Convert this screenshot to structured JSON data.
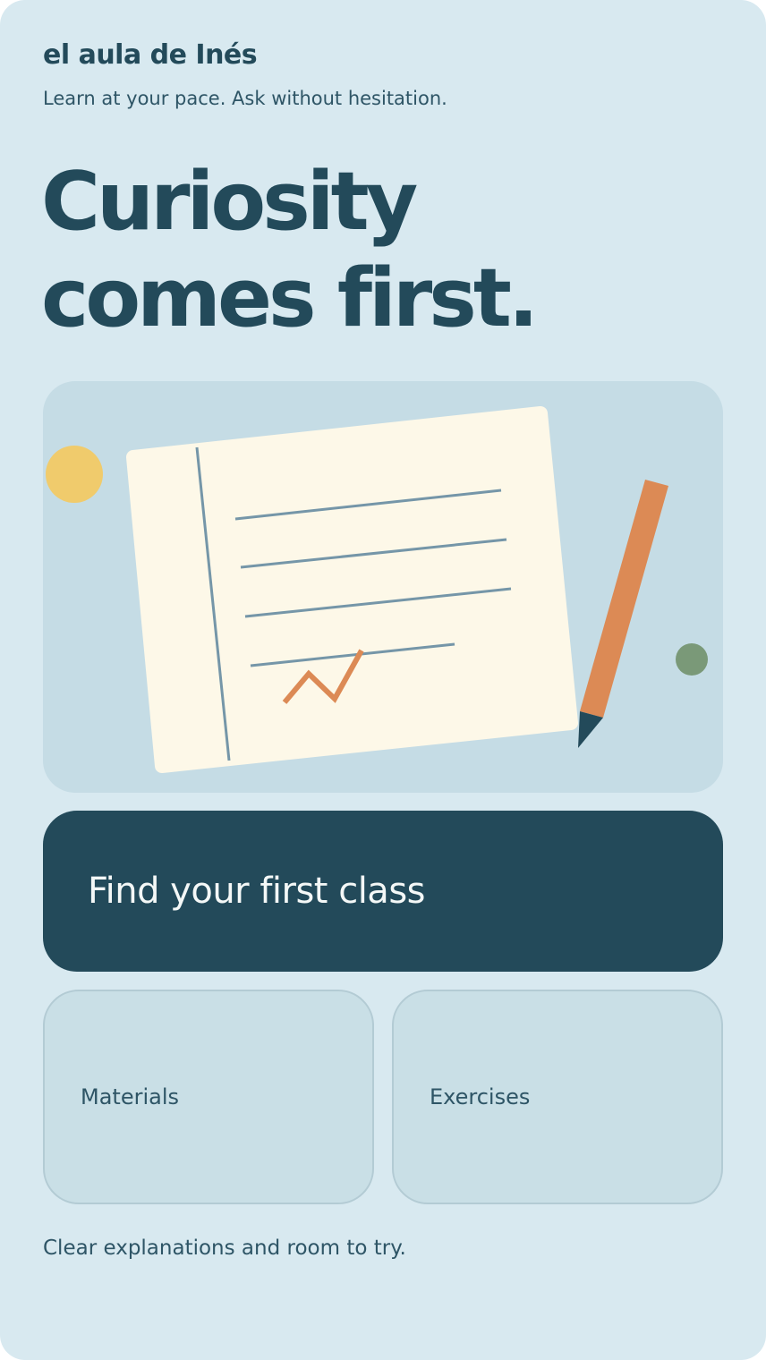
{
  "header": {
    "brand": "el aula de Inés",
    "tagline": "Learn at your pace. Ask without hesitation."
  },
  "hero": {
    "headline_line1": "Curiosity",
    "headline_line2": "comes first."
  },
  "illustration": {
    "icons": [
      "notebook-icon",
      "pencil-icon",
      "sun-dot-icon",
      "green-dot-icon",
      "zigzag-mark-icon"
    ]
  },
  "actions": {
    "primary_label": "Find your first class",
    "tiles": [
      {
        "label": "Materials"
      },
      {
        "label": "Exercises"
      }
    ]
  },
  "footer": {
    "note": "Clear explanations and room to try."
  },
  "colors": {
    "background": "#d8e9f0",
    "primary": "#234a5a",
    "panel": "#c5dce5",
    "paper": "#fdf8e8",
    "accent_orange": "#dc8a55",
    "accent_yellow": "#f0cb6c",
    "accent_green": "#7a9978",
    "line_blue": "#7596a8"
  }
}
